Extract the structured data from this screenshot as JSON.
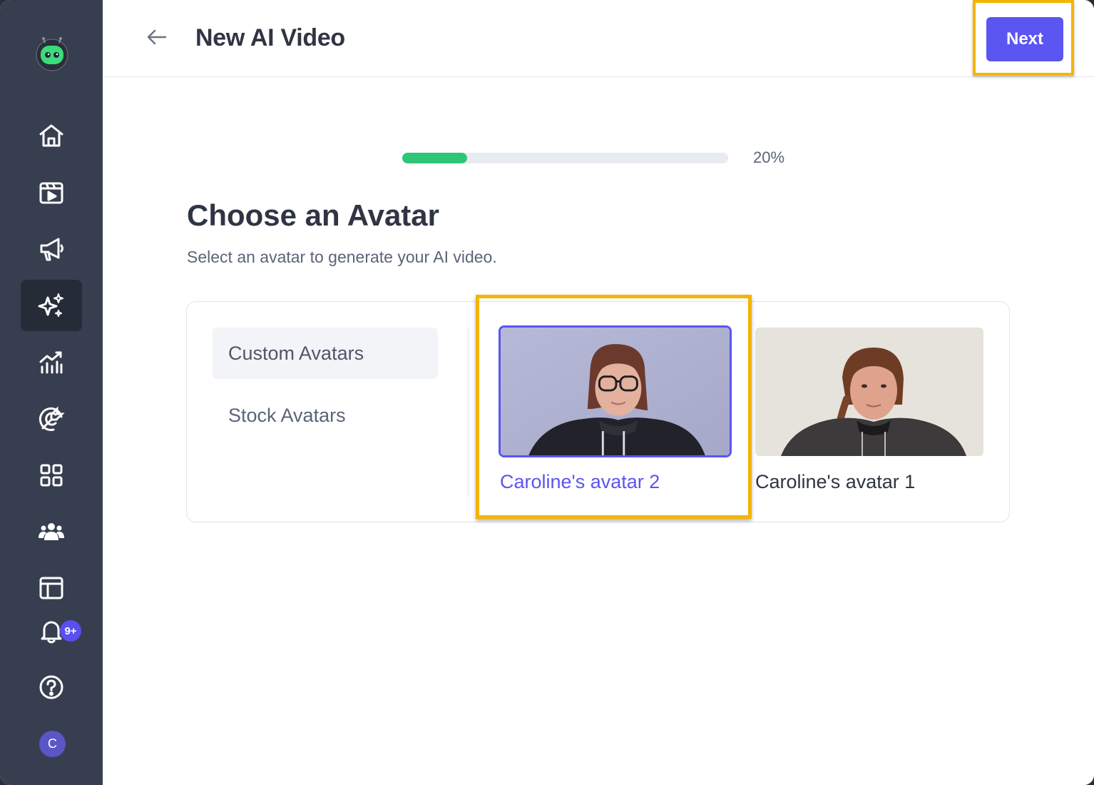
{
  "header": {
    "title": "New AI Video",
    "next_label": "Next"
  },
  "sidebar": {
    "items": [
      {
        "name": "home-icon",
        "active": false
      },
      {
        "name": "video-library-icon",
        "active": false
      },
      {
        "name": "megaphone-icon",
        "active": false
      },
      {
        "name": "sparkles-icon",
        "active": true
      },
      {
        "name": "analytics-icon",
        "active": false
      },
      {
        "name": "target-icon",
        "active": false
      },
      {
        "name": "apps-grid-icon",
        "active": false
      },
      {
        "name": "team-icon",
        "active": false
      },
      {
        "name": "layout-icon",
        "active": false
      },
      {
        "name": "bell-icon",
        "active": false
      },
      {
        "name": "help-icon",
        "active": false
      }
    ],
    "notifications_badge": "9+",
    "user_initial": "C"
  },
  "progress": {
    "value": 0.2,
    "label": "20%"
  },
  "main": {
    "heading": "Choose an Avatar",
    "subheading": "Select an avatar to generate your AI video.",
    "tabs": [
      {
        "label": "Custom Avatars",
        "active": true
      },
      {
        "label": "Stock Avatars",
        "active": false
      }
    ],
    "avatars": [
      {
        "name": "Caroline's avatar 2",
        "selected": true
      },
      {
        "name": "Caroline's avatar 1",
        "selected": false
      }
    ]
  },
  "colors": {
    "accent": "#5b55f2",
    "progress": "#2fc576",
    "highlight": "#f5b400",
    "sidebar": "#373e4f"
  }
}
